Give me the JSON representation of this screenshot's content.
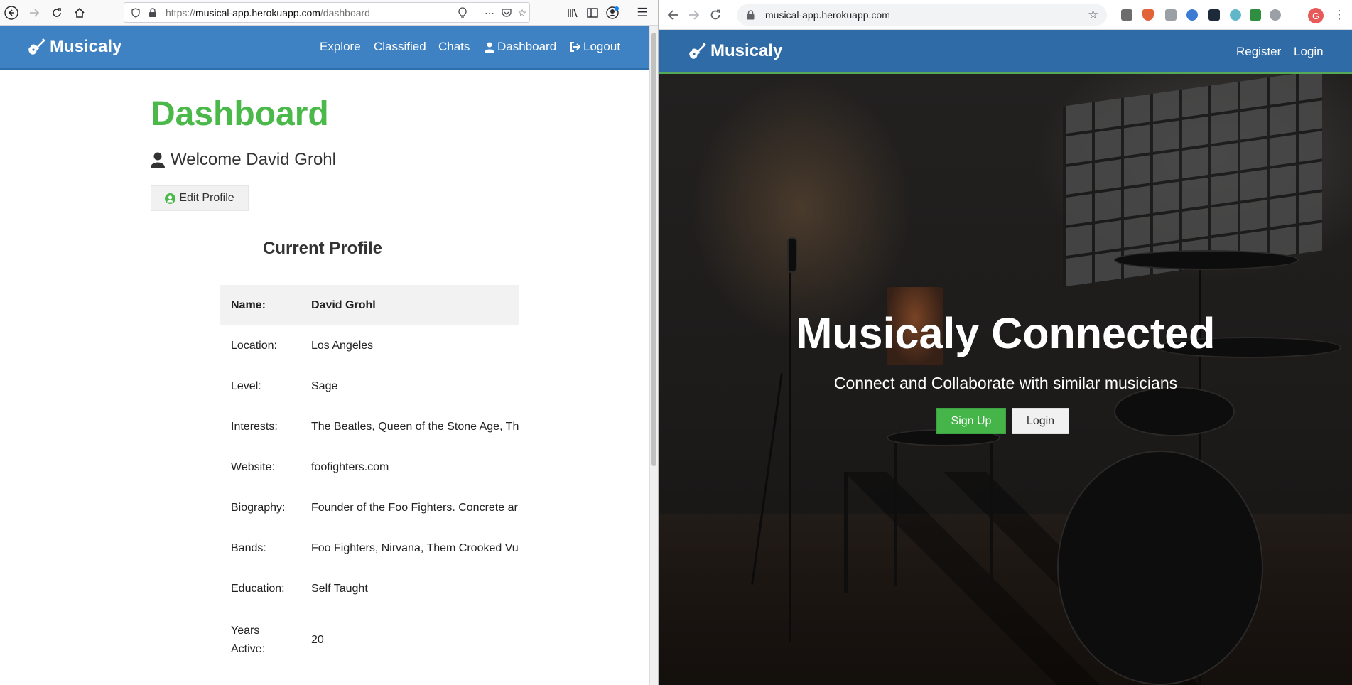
{
  "left_browser": {
    "url_prefix": "https://",
    "url_host": "musical-app.herokuapp.com",
    "url_path": "/dashboard"
  },
  "left_site": {
    "brand": "Musicaly",
    "nav": [
      "Explore",
      "Classified",
      "Chats",
      "Dashboard",
      "Logout"
    ]
  },
  "dashboard": {
    "title": "Dashboard",
    "welcome": "Welcome David Grohl",
    "edit_profile": "Edit Profile",
    "section_title": "Current Profile",
    "rows": [
      {
        "label": "Name:",
        "value": "David Grohl"
      },
      {
        "label": "Location:",
        "value": "Los Angeles"
      },
      {
        "label": "Level:",
        "value": "Sage"
      },
      {
        "label": "Interests:",
        "value": "The Beatles, Queen of the Stone Age, Th"
      },
      {
        "label": "Website:",
        "value": "foofighters.com"
      },
      {
        "label": "Biography:",
        "value": "Founder of the Foo Fighters. Concrete ar"
      },
      {
        "label": "Bands:",
        "value": "Foo Fighters, Nirvana, Them Crooked Vu"
      },
      {
        "label": "Education:",
        "value": "Self Taught"
      },
      {
        "label": "Years Active:",
        "value": "20"
      }
    ]
  },
  "right_browser": {
    "url": "musical-app.herokuapp.com",
    "avatar_letter": "G"
  },
  "right_site": {
    "brand": "Musicaly",
    "nav": [
      "Register",
      "Login"
    ],
    "hero_title": "Musicaly Connected",
    "hero_subtitle": "Connect and Collaborate with similar musicians",
    "signup_label": "Sign Up",
    "login_label": "Login"
  },
  "colors": {
    "navbar_blue": "#3f82c3",
    "brand_green": "#4ab94a"
  },
  "icons": [
    "guitar-icon",
    "user-icon",
    "user-circle-icon",
    "logout-icon",
    "lock-icon",
    "star-icon"
  ]
}
